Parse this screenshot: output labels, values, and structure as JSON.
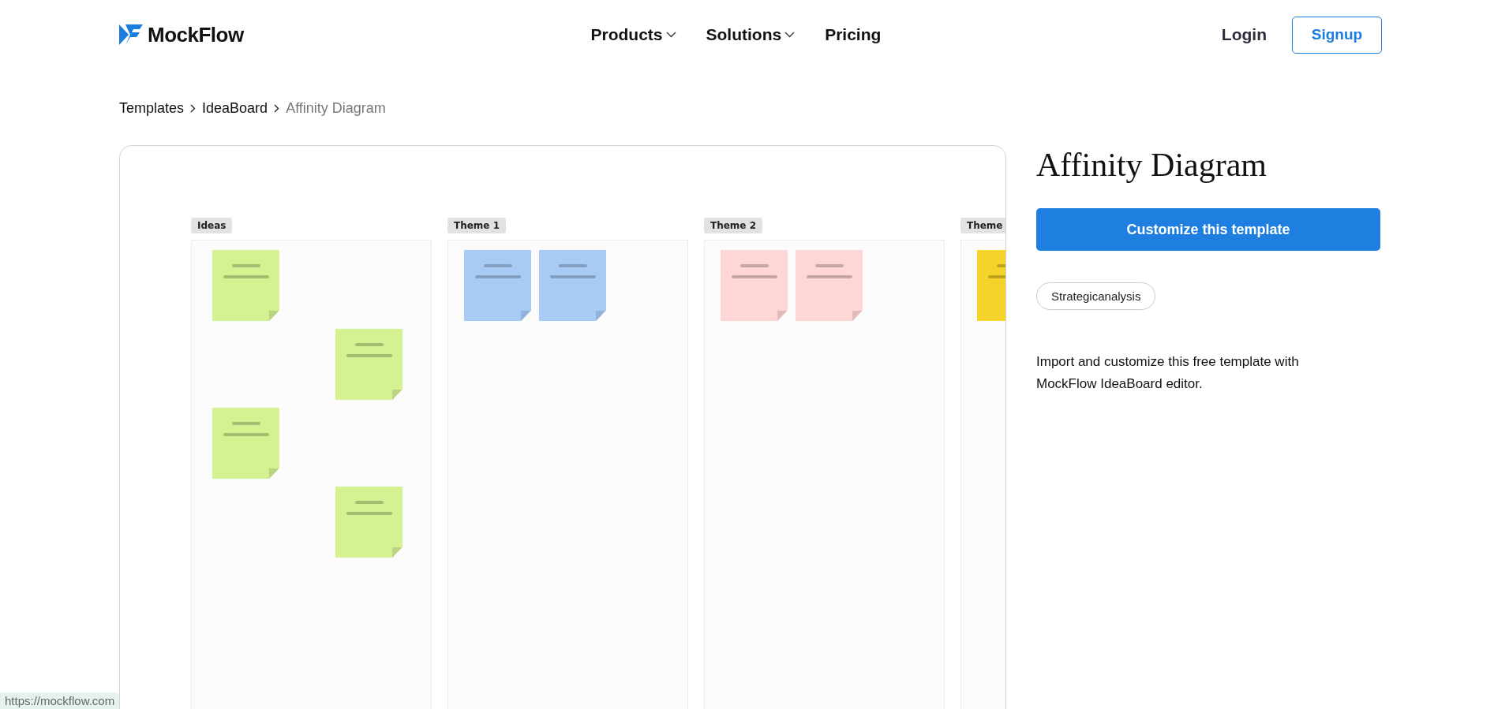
{
  "header": {
    "logo": "MockFlow",
    "nav": [
      {
        "label": "Products",
        "dropdown": true
      },
      {
        "label": "Solutions",
        "dropdown": true
      },
      {
        "label": "Pricing",
        "dropdown": false
      }
    ],
    "login": "Login",
    "signup": "Signup"
  },
  "breadcrumb": [
    {
      "label": "Templates",
      "current": false
    },
    {
      "label": "IdeaBoard",
      "current": false
    },
    {
      "label": "Affinity Diagram",
      "current": true
    }
  ],
  "board": {
    "columns": [
      {
        "label": "Ideas",
        "kind": "staggered",
        "notes": [
          {
            "color": "#d4f291"
          },
          {
            "color": "#d4f291"
          },
          {
            "color": "#d4f291"
          },
          {
            "color": "#d4f291"
          }
        ]
      },
      {
        "label": "Theme 1",
        "kind": "row",
        "notes": [
          {
            "color": "#a8cbf5"
          },
          {
            "color": "#a8cbf5"
          }
        ]
      },
      {
        "label": "Theme 2",
        "kind": "row",
        "notes": [
          {
            "color": "#fed6d6"
          },
          {
            "color": "#fed6d6"
          }
        ]
      },
      {
        "label": "Theme",
        "kind": "row",
        "notes": [
          {
            "color": "#f5d32a"
          }
        ]
      }
    ]
  },
  "details": {
    "title": "Affinity Diagram",
    "button": "Customize this template",
    "tags": [
      "Strategicanalysis"
    ],
    "description": "Import and customize this free template with MockFlow IdeaBoard editor."
  },
  "status_bar": "https://mockflow.com"
}
